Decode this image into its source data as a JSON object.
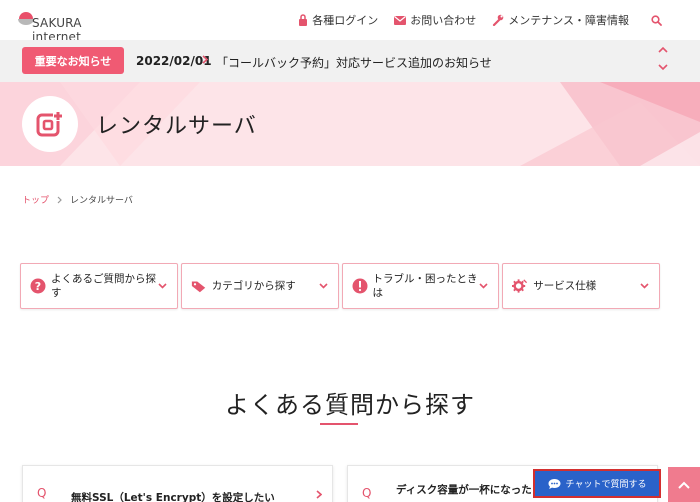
{
  "header": {
    "logo_text": "SAKURA internet",
    "nav": [
      {
        "label": "各種ログイン",
        "icon": "lock-icon"
      },
      {
        "label": "お問い合わせ",
        "icon": "mail-icon"
      },
      {
        "label": "メンテナンス・障害情報",
        "icon": "wrench-icon"
      }
    ],
    "search_icon": "search-icon"
  },
  "notice": {
    "badge": "重要なお知らせ",
    "date": "2022/02/01",
    "text": "「コールバック予約」対応サービス追加のお知らせ"
  },
  "hero": {
    "title": "レンタルサーバ",
    "icon": "server-app-icon"
  },
  "breadcrumb": {
    "home": "トップ",
    "current": "レンタルサーバ"
  },
  "categories": [
    {
      "label": "よくあるご質問から探す",
      "icon": "question-icon"
    },
    {
      "label": "カテゴリから探す",
      "icon": "tag-icon"
    },
    {
      "label": "トラブル・困ったときは",
      "icon": "alert-icon"
    },
    {
      "label": "サービス仕様",
      "icon": "gear-icon"
    }
  ],
  "section": {
    "title": "よくある質問から探す"
  },
  "faqs": [
    {
      "q": "Q",
      "text": "無料SSL（Let's Encrypt）を設定したい"
    },
    {
      "q": "Q",
      "text": "ディスク容量が一杯になった"
    }
  ],
  "chat": {
    "label": "チャットで質問する"
  },
  "colors": {
    "accent": "#e4546d",
    "badge": "#f05a73",
    "chat": "#2a62c9",
    "hero_bg": "#fde3e7"
  }
}
